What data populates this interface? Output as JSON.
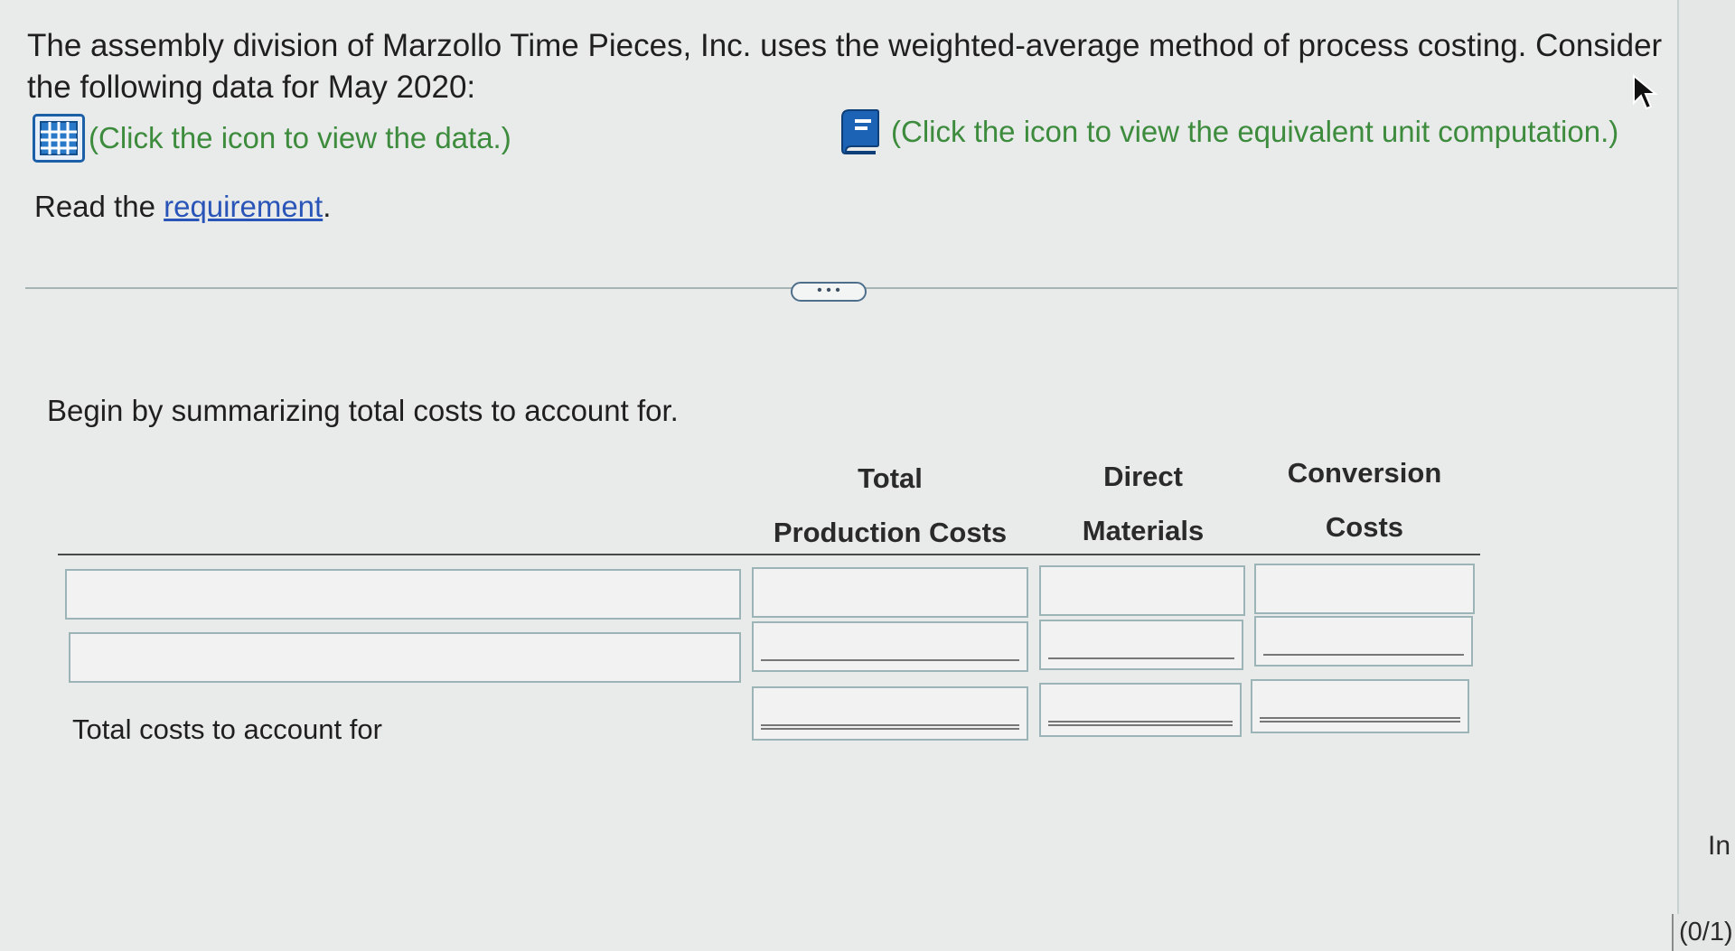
{
  "problem": {
    "line1": "The assembly division of Marzollo Time Pieces, Inc. uses the weighted-average method of process costing. Consider",
    "line2": "the following data for May 2020:"
  },
  "links": {
    "data_link_text": "(Click the icon to view the data.)",
    "equiv_link_text": "(Click the icon to view the equivalent unit computation.)",
    "read_prefix": "Read the ",
    "requirement_text": "requirement",
    "read_suffix": "."
  },
  "expand_button": "• • •",
  "instruction": "Begin by summarizing total costs to account for.",
  "table": {
    "columns": [
      {
        "line1": "Total",
        "line2": "Production Costs"
      },
      {
        "line1": "Direct",
        "line2": "Materials"
      },
      {
        "line1": "Conversion",
        "line2": "Costs"
      }
    ],
    "total_row_label": "Total costs to account for"
  },
  "side": {
    "label": "In",
    "score": "(0/1)"
  },
  "colors": {
    "link_green": "#3d8b3d",
    "link_blue": "#2a55b8",
    "icon_blue": "#1b5fa7"
  },
  "icons": [
    "data-table-icon",
    "equivalent-units-book-icon",
    "mouse-pointer-icon"
  ]
}
